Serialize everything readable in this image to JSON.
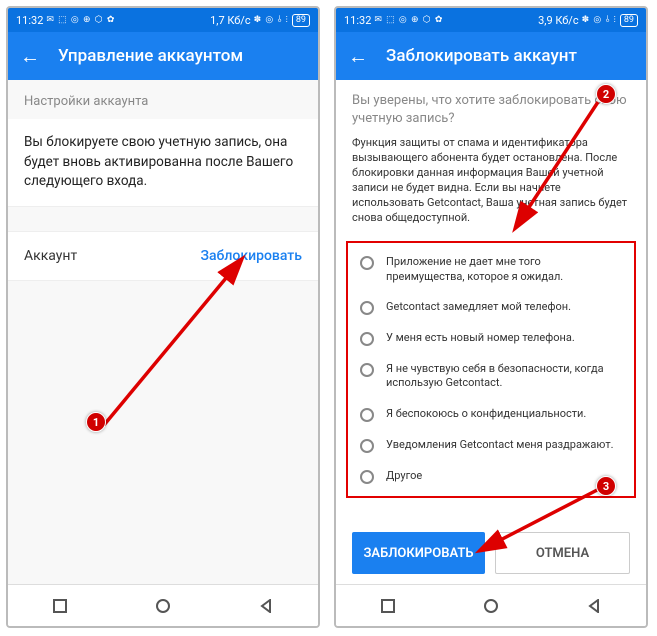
{
  "statusbar": {
    "time": "11:32",
    "icons_left": "✉ ⬚ ◎ ⊕ ⬡ ✿",
    "speed1": "1,7 Кб/с",
    "speed2": "3,9 Кб/с",
    "icons_right": "✽ ◎ ⫰ ⫶",
    "battery": "89"
  },
  "left": {
    "header_title": "Управление аккаунтом",
    "section_title": "Настройки аккаунта",
    "info_text": "Вы блокируете свою учетную запись, она будет вновь активированна после Вашего следующего входа.",
    "account_label": "Аккаунт",
    "block_link": "Заблокировать"
  },
  "right": {
    "header_title": "Заблокировать аккаунт",
    "confirm_title": "Вы уверены, что хотите заблокировать свою учетную запись?",
    "small_text": "Функция защиты от спама и идентификатора вызывающего абонента будет остановлена. После блокировки данная информация Вашей учетной записи не будет видна. Если вы начнете использовать Getcontact, Ваша учетная запись будет снова общедоступной.",
    "reasons": [
      "Приложение не дает мне того преимущества, которое я ожидал.",
      "Getcontact замедляет мой телефон.",
      "У меня есть новый номер телефона.",
      "Я не чувствую себя в безопасности, когда использую Getcontact.",
      "Я беспокоюсь о конфиденциальности.",
      "Уведомления Getcontact меня раздражают.",
      "Другое"
    ],
    "btn_block": "ЗАБЛОКИРОВАТЬ",
    "btn_cancel": "ОТМЕНА"
  },
  "callouts": {
    "c1": "1",
    "c2": "2",
    "c3": "3"
  }
}
